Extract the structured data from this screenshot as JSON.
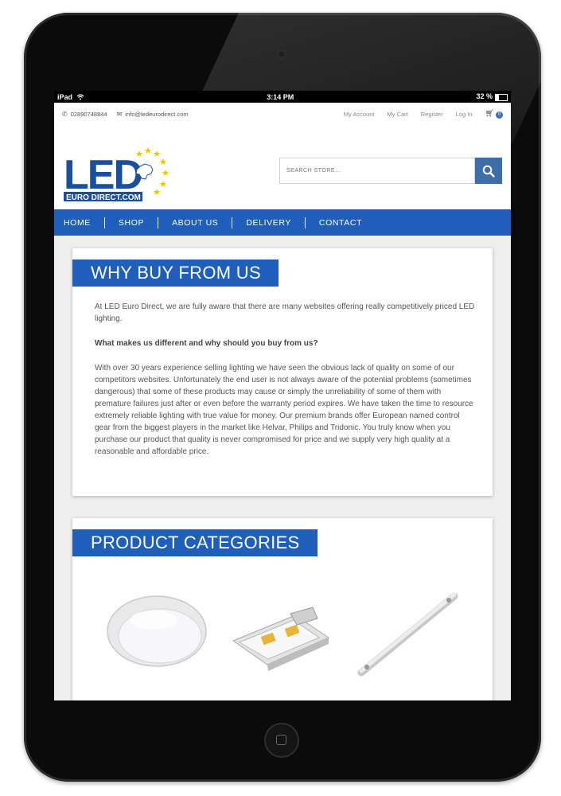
{
  "status_bar": {
    "device": "iPad",
    "time": "3:14 PM",
    "battery": "32 %"
  },
  "topbar": {
    "phone": "02890748844",
    "email": "info@ledeurodirect.com",
    "links": [
      "My Account",
      "My Cart",
      "Register",
      "Log In"
    ],
    "cart_count": "0"
  },
  "logo": {
    "text_main": "LED",
    "text_sub": "EURO DIRECT.COM"
  },
  "search": {
    "placeholder": "SEARCH STORE..."
  },
  "nav": {
    "items": [
      "HOME",
      "SHOP",
      "ABOUT US",
      "DELIVERY",
      "CONTACT"
    ]
  },
  "why_buy": {
    "title": "WHY BUY FROM US",
    "intro": "At LED Euro Direct, we are fully aware that there are many websites offering really competitively priced LED lighting.",
    "question": "What makes us different and why should you buy from us?",
    "body": "With over 30 years experience selling lighting we have seen the obvious lack of quality on some of our competitors websites. Unfortunately the end user is not always aware of the potential problems (sometimes dangerous) that some of these products may cause or simply the unreliability of some of them with premature failures just after or even before the warranty period expires. We have taken the time to resource extremely reliable lighting with true value for money. Our premium brands offer European named control gear from the biggest players in the market like Helvar, Philips and Tridonic. You truly know when you purchase our product that quality is never compromised for price and we supply very high quality at a reasonable and affordable price."
  },
  "product_categories": {
    "title": "PRODUCT CATEGORIES"
  },
  "colors": {
    "brand_blue": "#1f5fbb",
    "search_button": "#3e6eaa"
  }
}
